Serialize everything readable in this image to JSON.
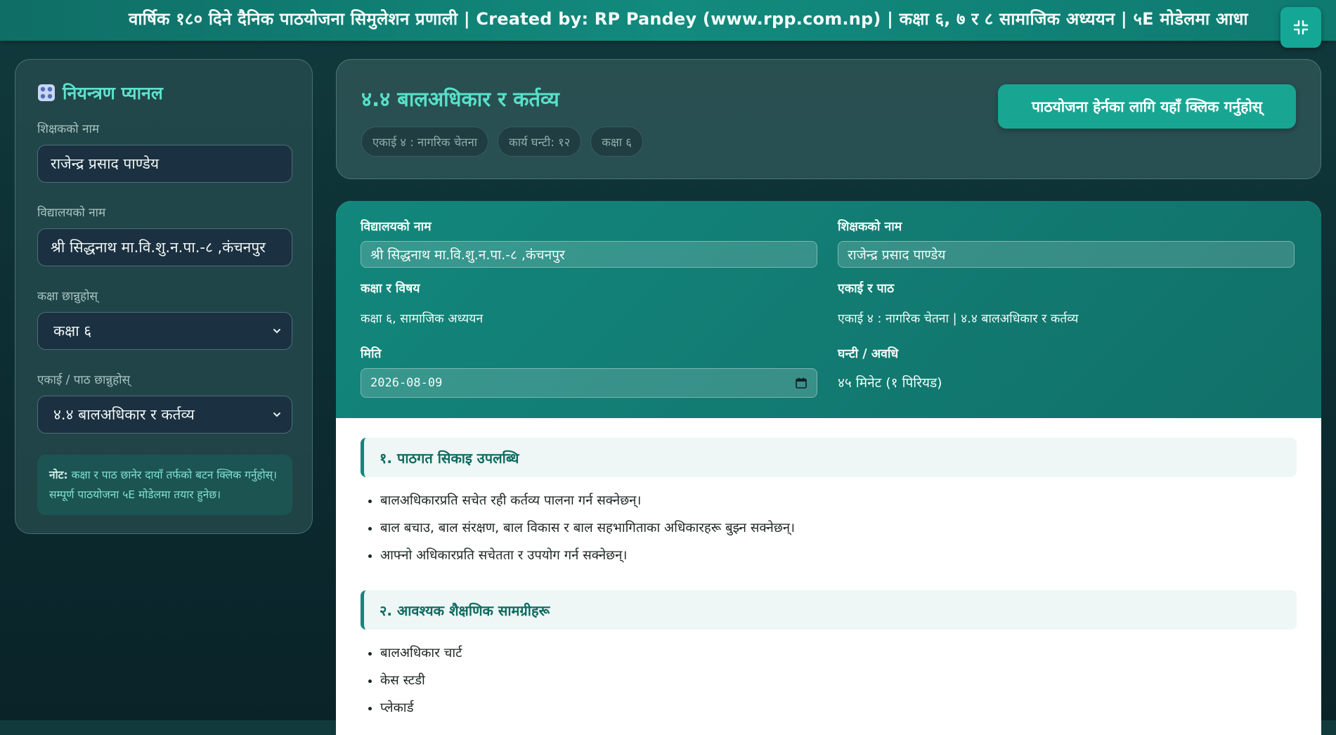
{
  "marquee": {
    "text": "वार्षिक १८० दिने दैनिक पाठयोजना सिमुलेशन प्रणाली | Created by: RP Pandey (www.rpp.com.np)   |   कक्षा ६, ७ र ८ सामाजिक अध्ययन | ५E मोडेलमा आधा"
  },
  "sidebar": {
    "title": "नियन्त्रण प्यानल",
    "teacher_label": "शिक्षकको नाम",
    "teacher_value": "राजेन्द्र प्रसाद पाण्डेय",
    "school_label": "विद्यालयको नाम",
    "school_value": "श्री सिद्धनाथ मा.वि.शु.न.पा.-८ ,कंचनपुर",
    "class_label": "कक्षा छान्नुहोस्",
    "class_value": "कक्षा ६",
    "lesson_label": "एकाई / पाठ छान्नुहोस्",
    "lesson_value": "४.४ बालअधिकार र कर्तव्य",
    "note_bold": "नोट:",
    "note_text": " कक्षा र पाठ छानेर दायाँ तर्फको बटन क्लिक गर्नुहोस्। सम्पूर्ण पाठयोजना ५E मोडेलमा तयार हुनेछ।"
  },
  "header": {
    "title": "४.४ बालअधिकार र कर्तव्य",
    "tags": [
      "एकाई ४ : नागरिक चेतना",
      "कार्य घन्टी: १२",
      "कक्षा ६"
    ],
    "button_label": "पाठयोजना हेर्नका लागि यहाँ क्लिक गर्नुहोस्"
  },
  "info": {
    "school_label": "विद्यालयको नाम",
    "school_value": "श्री सिद्धनाथ मा.वि.शु.न.पा.-८ ,कंचनपुर",
    "teacher_label": "शिक्षकको नाम",
    "teacher_value": "राजेन्द्र प्रसाद पाण्डेय",
    "class_subject_label": "कक्षा र विषय",
    "class_subject_value": "कक्षा ६, सामाजिक अध्ययन",
    "unit_lesson_label": "एकाई र पाठ",
    "unit_lesson_value": "एकाई ४ : नागरिक चेतना | ४.४ बालअधिकार र कर्तव्य",
    "date_label": "मिति",
    "date_value": "2026-08-09",
    "period_label": "घन्टी / अवधि",
    "period_value": "४५ मिनेट (१ पिरियड)"
  },
  "sections": [
    {
      "heading": "१. पाठगत सिकाइ उपलब्धि",
      "items": [
        "बालअधिकारप्रति सचेत रही कर्तव्य पालना गर्न सक्नेछन्।",
        "बाल बचाउ, बाल संरक्षण, बाल विकास र बाल सहभागिताका अधिकारहरू बुझ्न सक्नेछन्।",
        "आफ्नो अधिकारप्रति सचेतता र उपयोग गर्न सक्नेछन्।"
      ]
    },
    {
      "heading": "२. आवश्यक शैक्षणिक सामग्रीहरू",
      "items": [
        "बालअधिकार चार्ट",
        "केस स्टडी",
        "प्लेकार्ड"
      ]
    }
  ]
}
